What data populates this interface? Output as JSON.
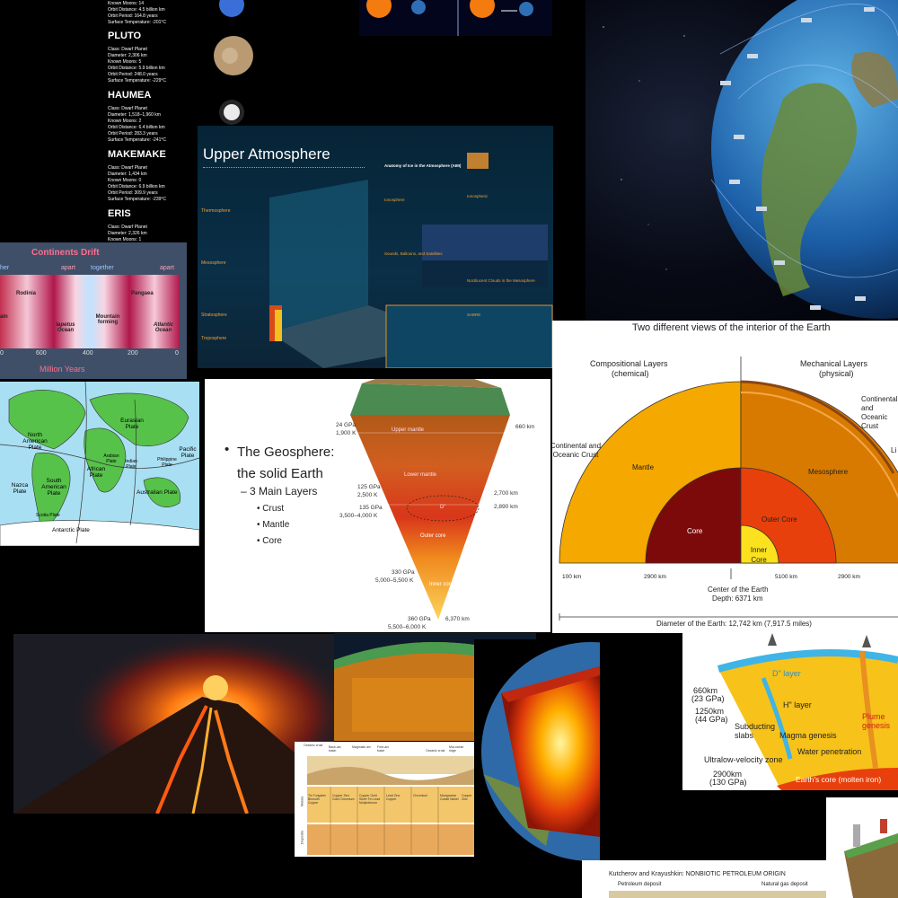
{
  "planets": {
    "top_line": "Known Moons: 14",
    "top_lines": [
      "Orbit Distance: 4.5 billion km",
      "Orbit Period: 164.8 years",
      "Surface Temperature: -201°C"
    ],
    "items": [
      {
        "name": "PLUTO",
        "lines": [
          "Class: Dwarf Planet",
          "Diameter: 2,306 km",
          "Known Moons: 5",
          "Orbit Distance: 5.9 billion km",
          "Orbit Period: 248.0 years",
          "Surface Temperature: -229°C"
        ]
      },
      {
        "name": "HAUMEA",
        "lines": [
          "Class: Dwarf Planet",
          "Diameter: 1,518–1,960 km",
          "Known Moons: 2",
          "Orbit Distance: 6.4 billion km",
          "Orbit Period: 283.3 years",
          "Surface Temperature: -241°C"
        ]
      },
      {
        "name": "MAKEMAKE",
        "lines": [
          "Class: Dwarf Planet",
          "Diameter: 1,434 km",
          "Known Moons: 0",
          "Orbit Distance: 6.9 billion km",
          "Orbit Period: 309.9 years",
          "Surface Temperature: -239°C"
        ]
      },
      {
        "name": "ERIS",
        "lines": [
          "Class: Dwarf Planet",
          "Diameter: 2,326 km",
          "Known Moons: 1"
        ]
      }
    ]
  },
  "atmosphere": {
    "title": "Upper Atmosphere",
    "layers": [
      "Thermosphere",
      "Mesosphere",
      "Stratosphere",
      "Troposphere"
    ],
    "headings": [
      "Anatomy of Ice in the Atmosphere (AIM)",
      "Ionosphere",
      "Ionospheric",
      "Noctilucent Clouds in the Mesosphere",
      "Sounds, Balloons, and Satellites",
      "SABRE"
    ]
  },
  "drift": {
    "title": "Continents Drift",
    "top_labels": [
      "her",
      "apart",
      "together",
      "apart"
    ],
    "labels": [
      "Rodinia",
      "Pangaea",
      "ain",
      "Iapetus Ocean",
      "Mountain forming",
      "Atlantic Ocean"
    ],
    "ticks": [
      "0",
      "600",
      "400",
      "200",
      "0"
    ],
    "axis": "Million Years"
  },
  "plates": {
    "labels": [
      "North American Plate",
      "Eurasian Plate",
      "Pacific Plate",
      "Arabian Plate",
      "Indian Plate",
      "Philippine Plate",
      "African Plate",
      "South American Plate",
      "Nazca Plate",
      "Australian Plate",
      "Scotia Plate",
      "Antarctic Plate"
    ]
  },
  "geosphere": {
    "bullet_title": "The Geosphere: the solid Earth",
    "sub": "– 3 Main Layers",
    "layers": [
      "Crust",
      "Mantle",
      "Core"
    ],
    "left_labels": [
      "24 GPa",
      "1,900 K",
      "125 GPa",
      "2,500 K",
      "135 GPa",
      "3,500–4,000 K",
      "330 GPa",
      "5,000–5,500 K",
      "360 GPa",
      "5,500–6,000 K"
    ],
    "right_labels": [
      "660 km",
      "2,700 km",
      "2,890 km",
      "6,370 km"
    ],
    "inner_labels": [
      "Upper mantle",
      "Lower mantle",
      "D\"",
      "Outer core",
      "Inner core"
    ]
  },
  "interior": {
    "title": "Two different views of the interior of the Earth",
    "left_head": "Compositional Layers",
    "left_sub": "(chemical)",
    "right_head": "Mechanical Layers",
    "right_sub": "(physical)",
    "labels": [
      "Continental and Oceanic Crust",
      "Continental and Oceanic Crust",
      "Mantle",
      "Mesosphere",
      "Core",
      "Outer Core",
      "Inner Core",
      "Li"
    ],
    "km": [
      "100 km",
      "2900 km",
      "5100 km",
      "2900 km"
    ],
    "center": "Center of the Earth",
    "depth": "Depth: 6371 km",
    "diameter": "Diameter of the Earth: 12,742 km (7,917.5 miles)"
  },
  "mantle_diagram": {
    "labels": [
      "660km",
      "(23 GPa)",
      "1250km",
      "(44 GPa)",
      "2900km",
      "(130 GPa)",
      "D\" layer",
      "H\" layer",
      "Subducting slabs",
      "Magma genesis",
      "Plume genesis",
      "Ultralow-velocity zone",
      "Water penetration",
      "Earth's core (molten iron)"
    ]
  },
  "ore": {
    "rows": [
      "Metals",
      "Deposits"
    ],
    "heads": [
      "Oceanic crust",
      "Back-arc basin",
      "Magmatic arc",
      "Fore-arc basin",
      "Oceanic crust",
      "Mid-ocean ridge"
    ],
    "metals": [
      "Tin Tungsten Bismuth Copper",
      "Copper Zinc Gold Chromium",
      "Copper Gold Silver Tin Lead Molybdenum",
      "Lead Zinc Copper",
      "Chromium",
      "Manganese Cobalt Nickel",
      "Copper Zinc"
    ]
  },
  "petro": {
    "title": "Kutcherov and Krayushkin: NONBIOTIC PETROLEUM ORIGIN",
    "left": "Petroleum deposit",
    "right": "Natural gas deposit"
  },
  "colors": {
    "accent": "#f5b400",
    "core": "#8b0a0a",
    "outer_core": "#e8400c",
    "drift_red": "#b0174a"
  }
}
